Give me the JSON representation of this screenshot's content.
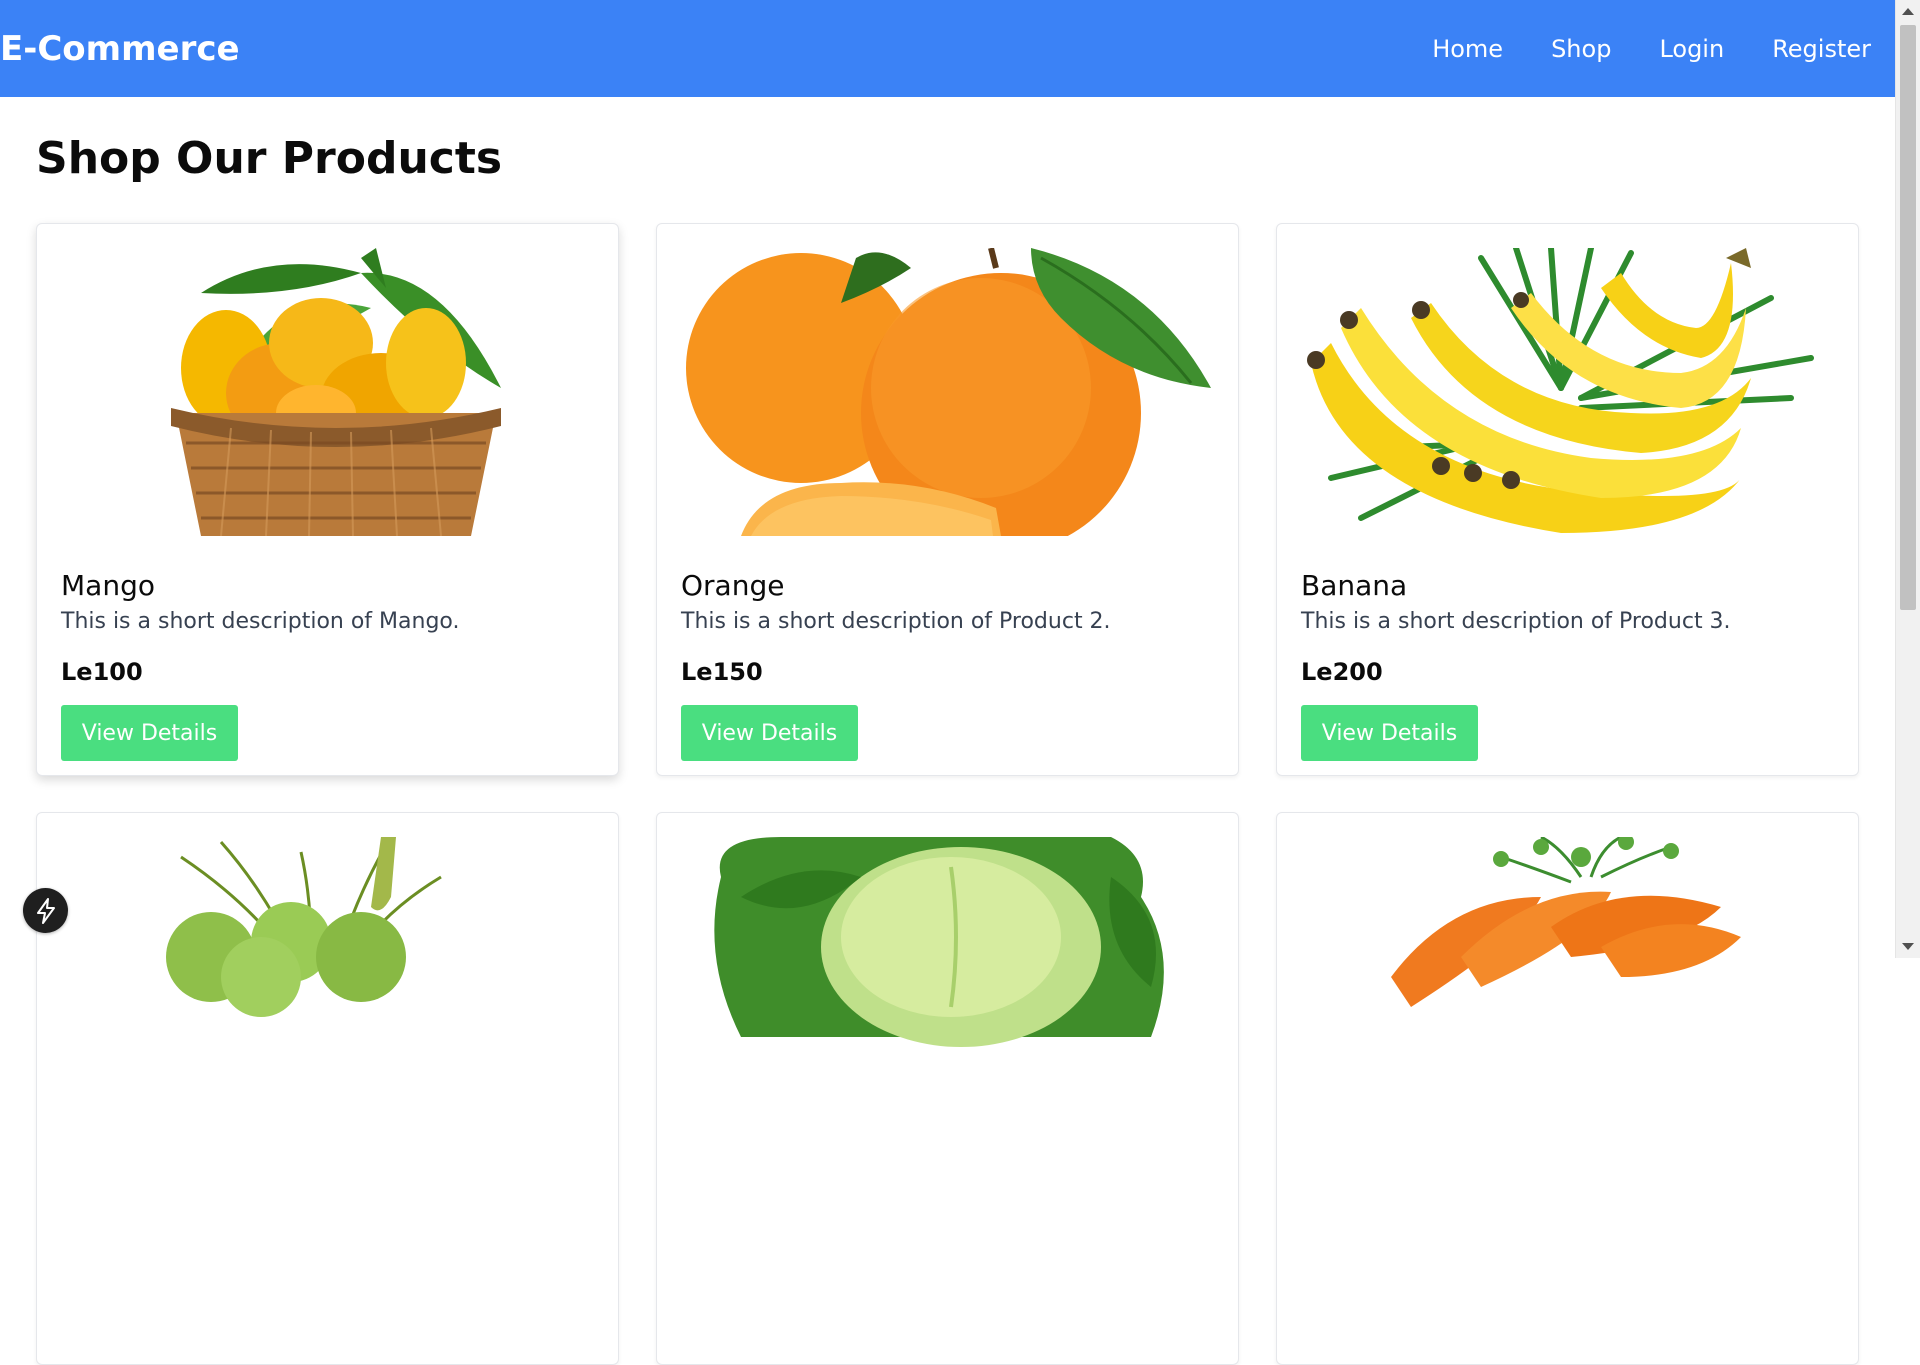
{
  "navbar": {
    "brand": "E-Commerce",
    "links": [
      "Home",
      "Shop",
      "Login",
      "Register"
    ]
  },
  "page": {
    "title": "Shop Our Products"
  },
  "products": [
    {
      "name": "Mango",
      "description": "This is a short description of Mango.",
      "price": "Le100",
      "button": "View Details",
      "image_icon": "mango-basket-image"
    },
    {
      "name": "Orange",
      "description": "This is a short description of Product 2.",
      "price": "Le150",
      "button": "View Details",
      "image_icon": "oranges-image"
    },
    {
      "name": "Banana",
      "description": "This is a short description of Product 3.",
      "price": "Le200",
      "button": "View Details",
      "image_icon": "bananas-image"
    }
  ],
  "partial_products": [
    {
      "image_icon": "green-coconuts-image"
    },
    {
      "image_icon": "cabbage-image"
    },
    {
      "image_icon": "carrots-image"
    }
  ],
  "floating_action": {
    "icon": "bolt-icon"
  },
  "colors": {
    "navbar_bg": "#3b82f6",
    "button_bg": "#4ade80",
    "text_dark": "#0b0b0b",
    "text_muted": "#374151"
  }
}
